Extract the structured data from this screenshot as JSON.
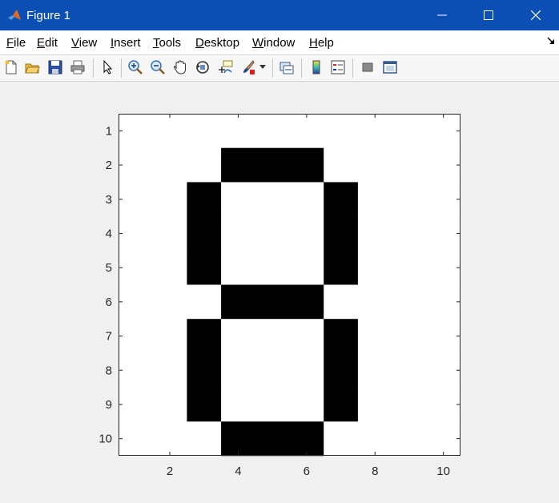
{
  "window": {
    "title": "Figure 1",
    "icons": [
      "matlab-logo-icon",
      "minimize-icon",
      "maximize-icon",
      "close-icon"
    ]
  },
  "menubar": {
    "items": [
      {
        "key": "F",
        "rest": "ile"
      },
      {
        "key": "E",
        "rest": "dit"
      },
      {
        "key": "V",
        "rest": "iew"
      },
      {
        "key": "I",
        "rest": "nsert"
      },
      {
        "key": "T",
        "rest": "ools"
      },
      {
        "key": "D",
        "rest": "esktop"
      },
      {
        "key": "W",
        "rest": "indow"
      },
      {
        "key": "H",
        "rest": "elp"
      }
    ]
  },
  "toolbar": {
    "icons": [
      "new-figure-icon",
      "open-file-icon",
      "save-icon",
      "print-icon",
      "edit-plot-arrow-icon",
      "zoom-in-icon",
      "zoom-out-icon",
      "pan-hand-icon",
      "rotate-3d-icon",
      "data-cursor-icon",
      "brush-icon",
      "link-plot-icon",
      "colorbar-icon",
      "legend-icon",
      "hide-plot-tools-icon",
      "show-plot-tools-icon"
    ]
  },
  "chart_data": {
    "type": "heatmap",
    "colormap": {
      "0": "#000000",
      "1": "#ffffff"
    },
    "x_ticks": [
      "2",
      "4",
      "6",
      "8",
      "10"
    ],
    "y_ticks": [
      "1",
      "2",
      "3",
      "4",
      "5",
      "6",
      "7",
      "8",
      "9",
      "10"
    ],
    "xlim": [
      0.5,
      10.5
    ],
    "ylim": [
      0.5,
      10.5
    ],
    "y_direction": "reverse",
    "values": [
      [
        1,
        1,
        1,
        1,
        1,
        1,
        1,
        1,
        1,
        1
      ],
      [
        1,
        1,
        1,
        0,
        0,
        0,
        1,
        1,
        1,
        1
      ],
      [
        1,
        1,
        0,
        1,
        1,
        1,
        0,
        1,
        1,
        1
      ],
      [
        1,
        1,
        0,
        1,
        1,
        1,
        0,
        1,
        1,
        1
      ],
      [
        1,
        1,
        0,
        1,
        1,
        1,
        0,
        1,
        1,
        1
      ],
      [
        1,
        1,
        1,
        0,
        0,
        0,
        1,
        1,
        1,
        1
      ],
      [
        1,
        1,
        0,
        1,
        1,
        1,
        0,
        1,
        1,
        1
      ],
      [
        1,
        1,
        0,
        1,
        1,
        1,
        0,
        1,
        1,
        1
      ],
      [
        1,
        1,
        0,
        1,
        1,
        1,
        0,
        1,
        1,
        1
      ],
      [
        1,
        1,
        1,
        0,
        0,
        0,
        1,
        1,
        1,
        1
      ]
    ]
  }
}
